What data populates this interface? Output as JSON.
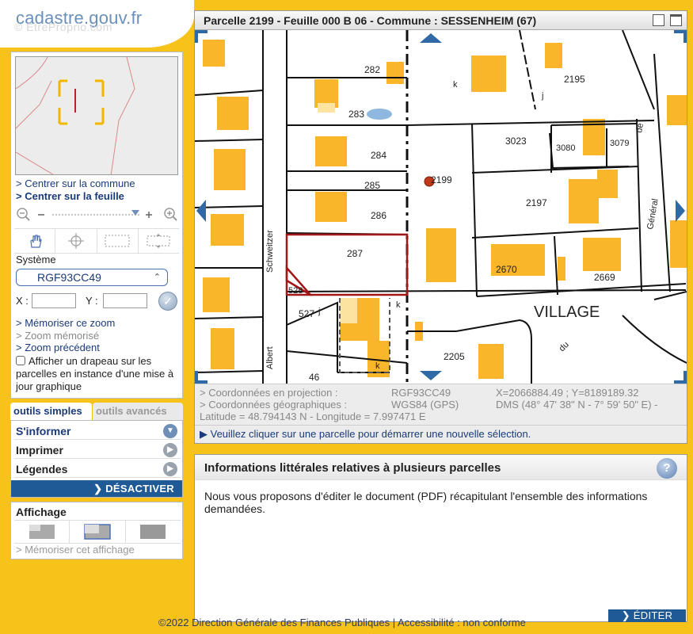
{
  "header": {
    "logo": "cadastre.gouv.fr",
    "watermark": "© EtreProprio.com"
  },
  "left": {
    "links": {
      "center_commune": "> Centrer sur la commune",
      "center_feuille": "> Centrer sur la feuille"
    },
    "zoom": {
      "minus": "−",
      "plus": "+"
    },
    "systeme_label": "Système",
    "systeme_value": "RGF93CC49",
    "x_label": "X :",
    "y_label": "Y :",
    "ok_label": "✓",
    "memo_links": {
      "memoriser": "> Mémoriser ce zoom",
      "memorise": "> Zoom mémorisé",
      "precedent": "> Zoom précédent"
    },
    "flag_text": "Afficher un drapeau sur les parcelles en instance d'une mise à jour graphique"
  },
  "tabs": {
    "simple": "outils simples",
    "advanced": "outils avancés"
  },
  "tools": {
    "items": [
      "S'informer",
      "Imprimer",
      "Légendes"
    ],
    "desactiver": "❯ DÉSACTIVER"
  },
  "affichage": {
    "title": "Affichage",
    "memoriser": "> Mémoriser cet affichage"
  },
  "map": {
    "title": "Parcelle 2199 - Feuille 000 B 06 - Commune : SESSENHEIM (67)",
    "labels": {
      "p282": "282",
      "p283": "283",
      "p284": "284",
      "p285": "285",
      "p286": "286",
      "p287": "287",
      "p528": "528",
      "p527": "527",
      "p46": "46",
      "p2199": "2199",
      "p2195": "2195",
      "p3023": "3023",
      "p3080": "3080",
      "p3079": "3079",
      "p2197": "2197",
      "p2670": "2670",
      "p2669": "2669",
      "p2205": "2205",
      "village": "VILLAGE",
      "schweitzer": "Schweitzer",
      "albert": "Albert",
      "general": "Général",
      "de": "de",
      "du": "du",
      "k": "k",
      "j": "j"
    }
  },
  "coords": {
    "proj_label": "> Coordonnées en projection :",
    "proj_system": "RGF93CC49",
    "proj_value": "X=2066884.49 ; Y=8189189.32",
    "geo_label": "> Coordonnées géographiques :",
    "geo_system": "WGS84 (GPS)",
    "geo_value": "DMS (48° 47' 38\" N - 7° 59' 50\" E) -",
    "latlon": "Latitude = 48.794143 N - Longitude = 7.997471 E"
  },
  "message": "▶ Veuillez cliquer sur une parcelle pour démarrer une nouvelle sélection.",
  "info": {
    "title": "Informations littérales relatives à plusieurs parcelles",
    "help": "?",
    "text": "Nous vous proposons d'éditer le document (PDF) récapitulant l'ensemble des informations demandées.",
    "editer": "❯ ÉDITER"
  },
  "footer": "©2022 Direction Générale des Finances Publiques  |   Accessibilité : non conforme",
  "colors": {
    "building": "#f9b62a",
    "accent": "#1f5a96",
    "selection": "#a11616",
    "link": "#1a3a7a"
  }
}
